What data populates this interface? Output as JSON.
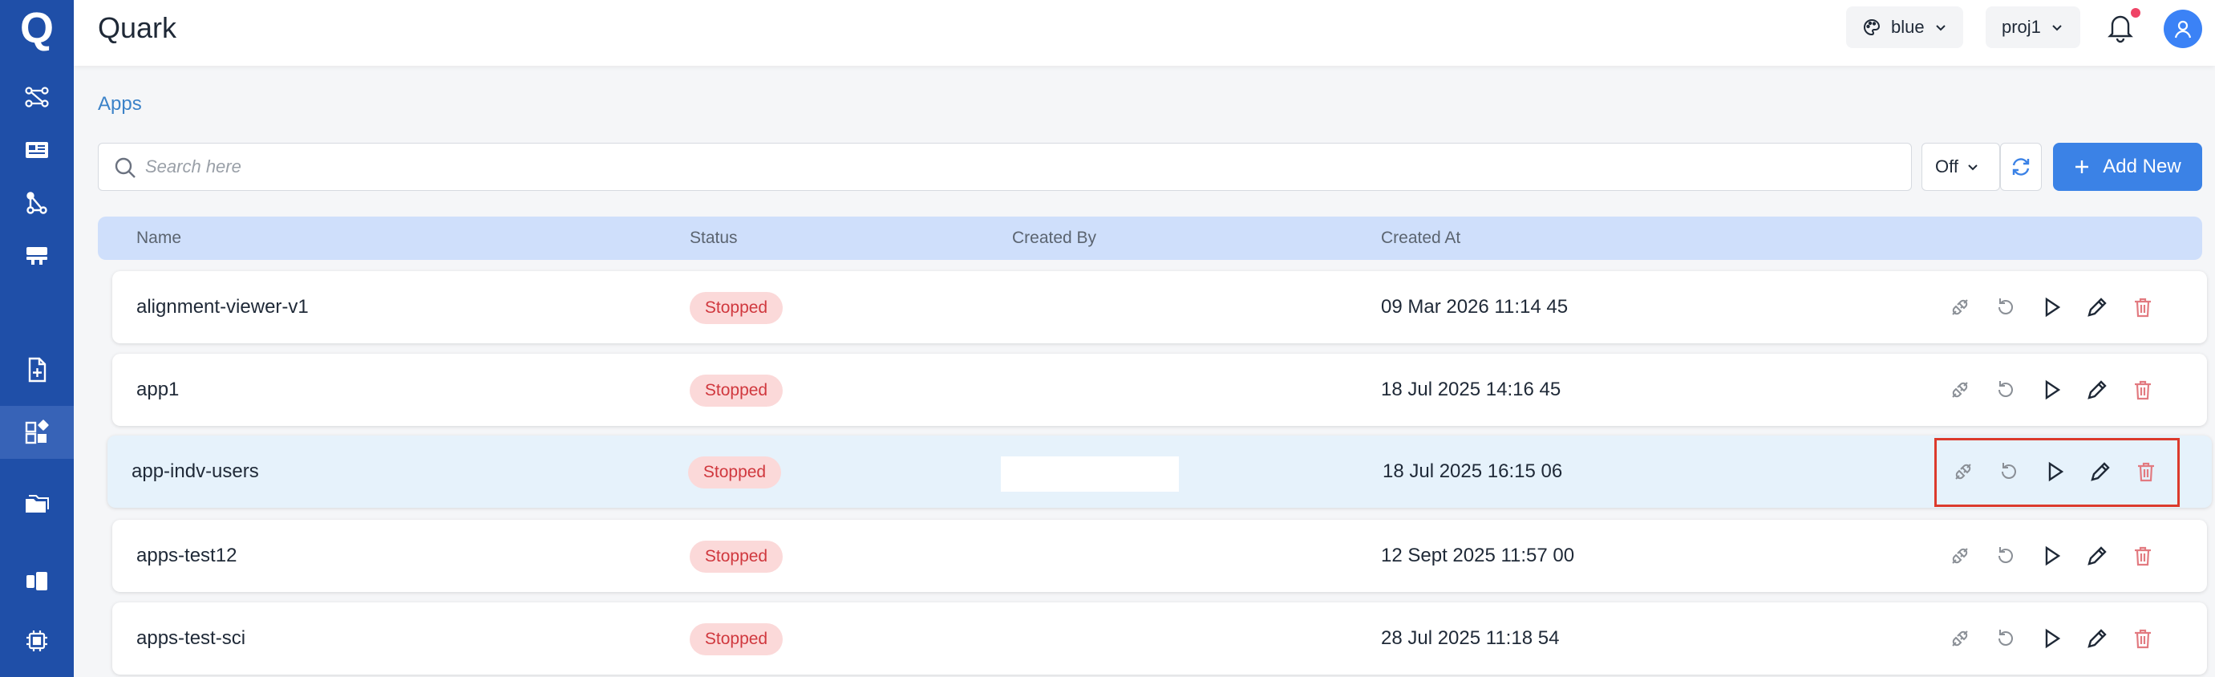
{
  "app": {
    "logo": "Q",
    "title": "Quark"
  },
  "sidebar": {
    "items": [
      {
        "icon": "workflow-icon"
      },
      {
        "icon": "news-card-icon"
      },
      {
        "icon": "graph-nodes-icon"
      },
      {
        "icon": "server-icon"
      },
      {
        "icon": "file-add-icon"
      },
      {
        "icon": "apps-icon",
        "active": true
      },
      {
        "icon": "folders-icon"
      },
      {
        "icon": "cards-icon"
      },
      {
        "icon": "chip-icon"
      }
    ]
  },
  "header": {
    "theme_label": "blue",
    "project_label": "proj1",
    "has_notification": true
  },
  "breadcrumb": "Apps",
  "toolbar": {
    "search_placeholder": "Search here",
    "auto_refresh_value": "Off",
    "add_label": "Add New"
  },
  "table": {
    "columns": [
      "Name",
      "Status",
      "Created By",
      "Created At"
    ],
    "rows": [
      {
        "name": "alignment-viewer-v1",
        "status": "Stopped",
        "created_by": "",
        "created_at": "09 Mar 2026 11:14 45"
      },
      {
        "name": "app1",
        "status": "Stopped",
        "created_by": "",
        "created_at": "18 Jul 2025 14:16 45"
      },
      {
        "name": "app-indv-users",
        "status": "Stopped",
        "created_by": "",
        "created_at": "18 Jul 2025 16:15 06",
        "selected": true
      },
      {
        "name": "apps-test12",
        "status": "Stopped",
        "created_by": "",
        "created_at": "12 Sept 2025 11:57 00"
      },
      {
        "name": "apps-test-sci",
        "status": "Stopped",
        "created_by": "",
        "created_at": "28 Jul 2025 11:18 54"
      }
    ],
    "row_actions": [
      "plug-icon",
      "restart-icon",
      "play-icon",
      "edit-icon",
      "delete-icon"
    ]
  },
  "colors": {
    "sidebar": "#1f4fa8",
    "accent": "#3b82e6",
    "status_stopped_bg": "#fbd9d9",
    "status_stopped_text": "#d0383e",
    "highlight": "#dc3a2c"
  }
}
